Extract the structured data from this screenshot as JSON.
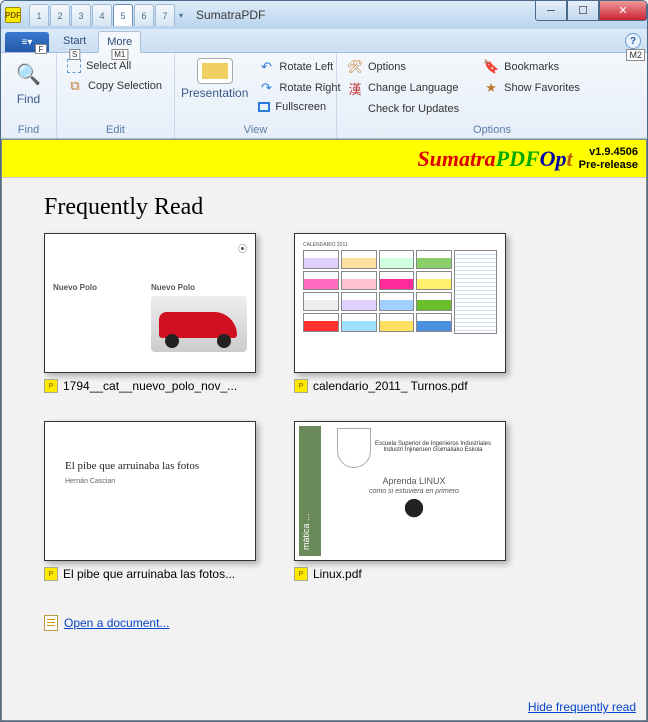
{
  "titlebar": {
    "app_name": "SumatraPDF",
    "qat_tabs": [
      "1",
      "2",
      "3",
      "4",
      "5",
      "6",
      "7"
    ],
    "qat_active_index": 4
  },
  "ribbon": {
    "file_label": "F",
    "tabs": [
      {
        "label": "Start",
        "keyhint": "S"
      },
      {
        "label": "More",
        "keyhint": "M1",
        "active": true
      }
    ],
    "help_hint": "M2",
    "groups": {
      "find": {
        "label": "Find",
        "find_btn": "Find"
      },
      "edit": {
        "label": "Edit",
        "select_all": "Select All",
        "copy_selection": "Copy Selection"
      },
      "view": {
        "label": "View",
        "presentation": "Presentation",
        "rotate_left": "Rotate Left",
        "rotate_right": "Rotate Right",
        "fullscreen": "Fullscreen"
      },
      "options": {
        "label": "Options",
        "options": "Options",
        "change_language": "Change Language",
        "check_updates": "Check for Updates",
        "bookmarks": "Bookmarks",
        "show_favorites": "Show Favorites"
      }
    }
  },
  "banner": {
    "brand_parts": [
      "Sumatra",
      "PDF",
      "Op",
      "t"
    ],
    "version": "v1.9.4506",
    "pre_release": "Pre-release"
  },
  "main": {
    "heading": "Frequently Read",
    "thumbs": [
      {
        "filename": "1794__cat__nuevo_polo_nov_...",
        "preview_title": "Nuevo Polo"
      },
      {
        "filename": "calendario_2011_ Turnos.pdf"
      },
      {
        "filename": "El pibe que arruinaba las fotos...",
        "preview_title": "El pibe que arruinaba las fotos",
        "preview_author": "Hernán Casciari"
      },
      {
        "filename": "Linux.pdf",
        "preview_uni": "Escuela Superior de Ingenieros Industriales\nIndustri Injineruen Goimaliako Eskola",
        "preview_side": "mática ...",
        "preview_title": "Aprenda LINUX",
        "preview_sub": "como si estuviera en primero"
      }
    ],
    "open_document": "Open a document...",
    "hide_link": "Hide frequently read"
  }
}
